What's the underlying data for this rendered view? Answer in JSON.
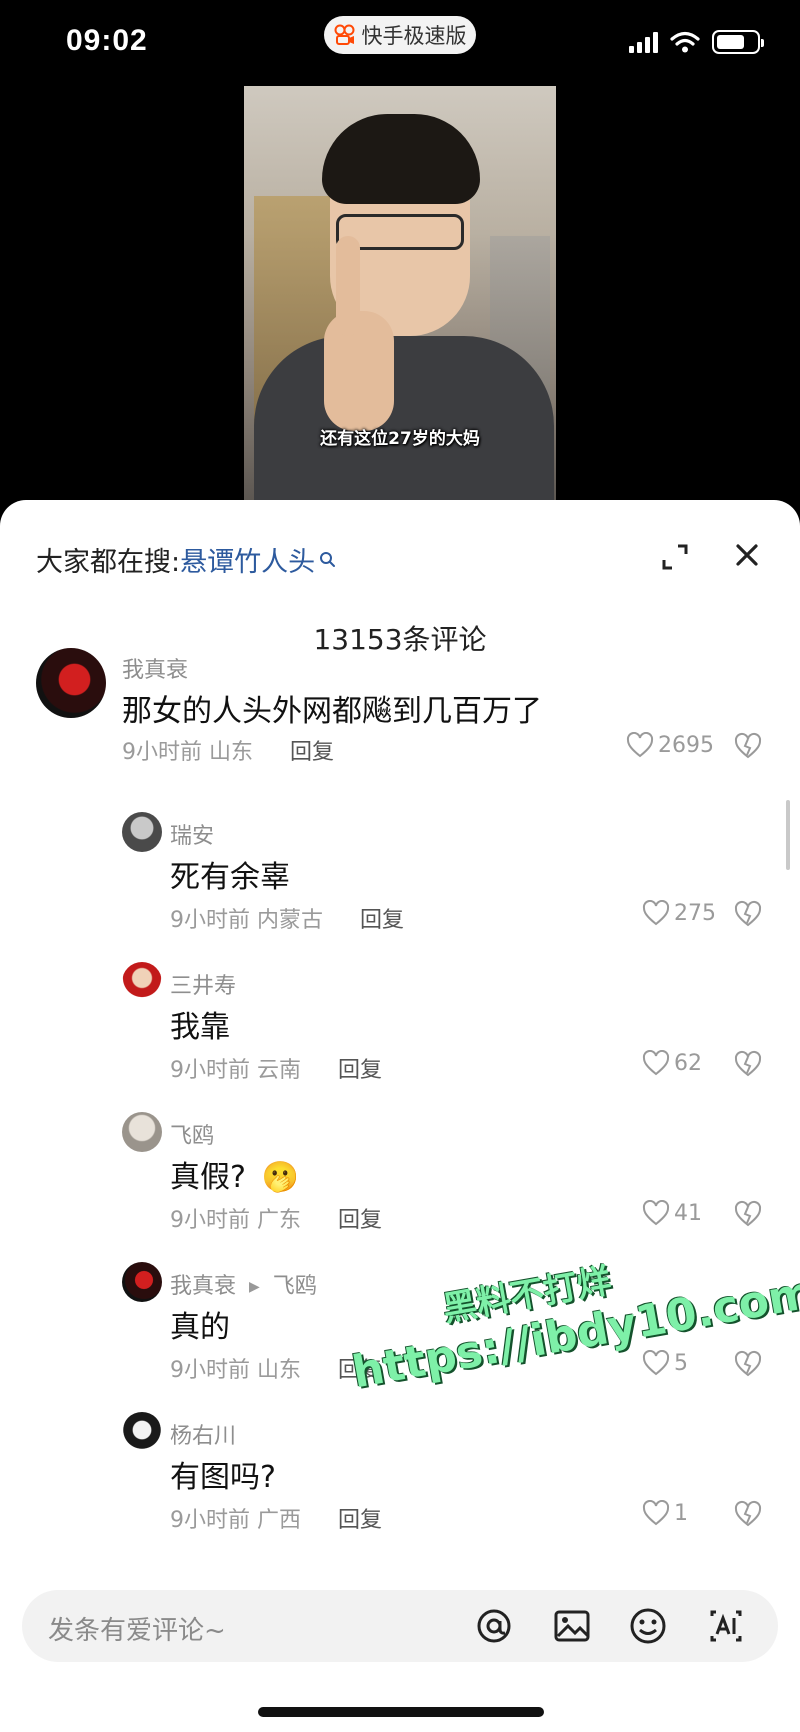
{
  "status_bar": {
    "time": "09:02",
    "app_name": "快手极速版"
  },
  "video": {
    "subtitle": "还有这位27岁的大妈"
  },
  "sheet": {
    "search_prefix": "大家都在搜:",
    "search_keyword": "悬谭竹人头",
    "comment_count": "13153条评论",
    "comments": [
      {
        "user": "我真衰",
        "text": "那女的人头外网都飚到几百万了",
        "time": "9小时前",
        "location": "山东",
        "reply": "回复",
        "likes": "2695"
      },
      {
        "user": "瑞安",
        "text": "死有余辜",
        "time": "9小时前",
        "location": "内蒙古",
        "reply": "回复",
        "likes": "275"
      },
      {
        "user": "三井寿",
        "text": "我靠",
        "time": "9小时前",
        "location": "云南",
        "reply": "回复",
        "likes": "62"
      },
      {
        "user": "飞鸥",
        "text": "真假?",
        "emoji": "🫢",
        "time": "9小时前",
        "location": "广东",
        "reply": "回复",
        "likes": "41"
      },
      {
        "user": "我真衰",
        "reply_to": "飞鸥",
        "text": "真的",
        "time": "9小时前",
        "location": "山东",
        "reply": "回复",
        "likes": "5"
      },
      {
        "user": "杨右川",
        "text": "有图吗?",
        "time": "9小时前",
        "location": "广西",
        "reply": "回复",
        "likes": "1"
      }
    ],
    "composer_placeholder": "发条有爱评论~",
    "watermark_line1": "黑料不打烊",
    "watermark_line2": "https://ibdy10.com"
  },
  "colors": {
    "keyword": "#2d5a9e",
    "watermark": "#7ef0a8"
  }
}
